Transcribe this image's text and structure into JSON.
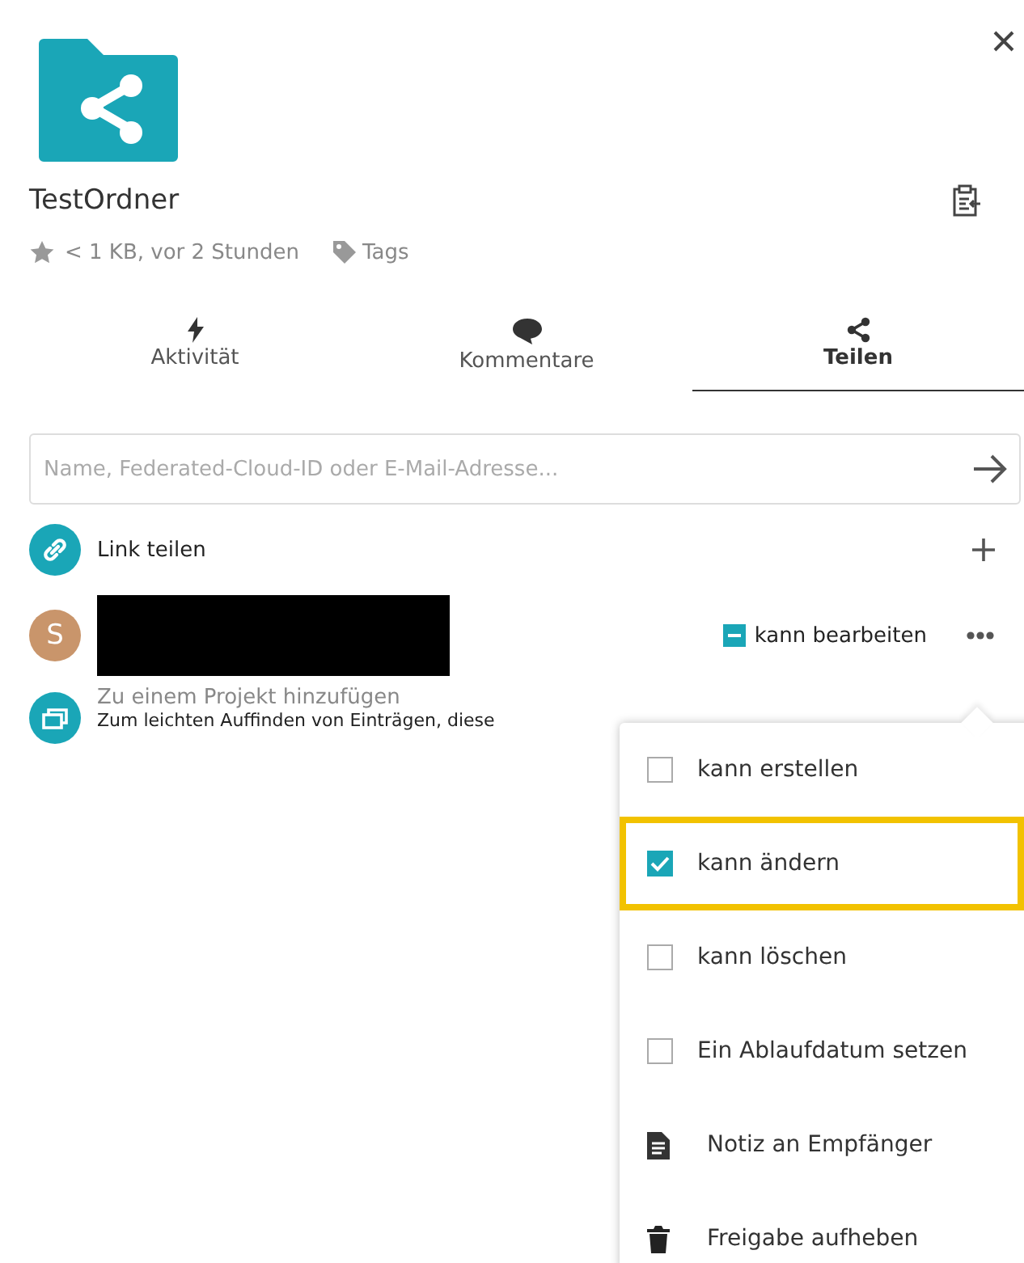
{
  "file": {
    "name": "TestOrdner",
    "favorite": false,
    "meta": "< 1 KB, vor 2 Stunden",
    "tags_label": "Tags"
  },
  "tabs": [
    {
      "label": "Aktivität",
      "kind": "activity",
      "selected": false
    },
    {
      "label": "Kommentare",
      "kind": "comments",
      "selected": false
    },
    {
      "label": "Teilen",
      "kind": "share",
      "selected": true
    }
  ],
  "share_input": {
    "placeholder": "Name, Federated-Cloud-ID oder E-Mail-Adresse..."
  },
  "link_share": {
    "label": "Link teilen"
  },
  "user_share": {
    "avatar_letter": "S",
    "permission_label": "kann bearbeiten",
    "indeterminate": true
  },
  "project": {
    "title": "Zu einem Projekt hinzufügen",
    "description": "Zum leichten Auffinden von Einträgen, diese"
  },
  "menu": [
    {
      "kind": "checkbox",
      "label": "kann erstellen",
      "checked": false,
      "highlighted": false
    },
    {
      "kind": "checkbox",
      "label": "kann ändern",
      "checked": true,
      "highlighted": true
    },
    {
      "kind": "checkbox",
      "label": "kann löschen",
      "checked": false,
      "highlighted": false
    },
    {
      "kind": "checkbox",
      "label": "Ein Ablaufdatum setzen",
      "checked": false,
      "highlighted": false
    },
    {
      "kind": "note",
      "label": "Notiz an Empfänger"
    },
    {
      "kind": "delete",
      "label": "Freigabe aufheben"
    }
  ]
}
